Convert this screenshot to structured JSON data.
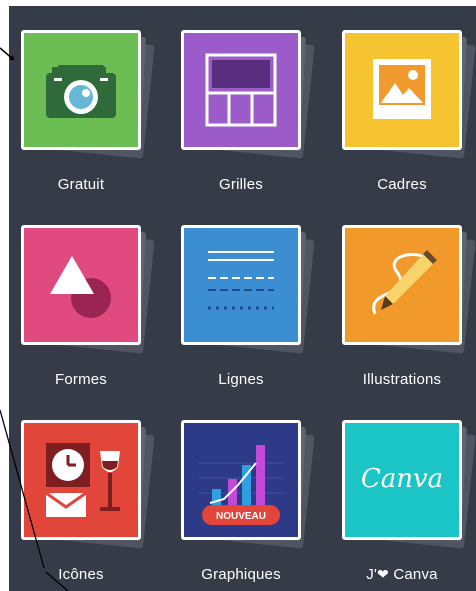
{
  "colors": {
    "panel_bg": "#363c47",
    "gratuit": "#6bbd54",
    "grilles": "#9b5bc9",
    "cadres": "#f6c431",
    "formes": "#e14a7f",
    "lignes": "#3b8ed1",
    "illustrations": "#f19a2b",
    "icones": "#e2463b",
    "graphiques": "#2c3a88",
    "canva": "#1cc5c5"
  },
  "tiles": [
    {
      "label": "Gratuit",
      "icon": "camera-icon"
    },
    {
      "label": "Grilles",
      "icon": "grid-layout-icon"
    },
    {
      "label": "Cadres",
      "icon": "picture-frame-icon"
    },
    {
      "label": "Formes",
      "icon": "shapes-icon"
    },
    {
      "label": "Lignes",
      "icon": "lines-icon"
    },
    {
      "label": "Illustrations",
      "icon": "pencil-icon"
    },
    {
      "label": "Icônes",
      "icon": "clock-envelope-glass-icon"
    },
    {
      "label": "Graphiques",
      "icon": "bar-chart-icon",
      "badge": "NOUVEAU"
    },
    {
      "label_prefix": "J'",
      "label_suffix": " Canva",
      "icon": "canva-logo-icon",
      "logo_text": "Canva"
    }
  ]
}
